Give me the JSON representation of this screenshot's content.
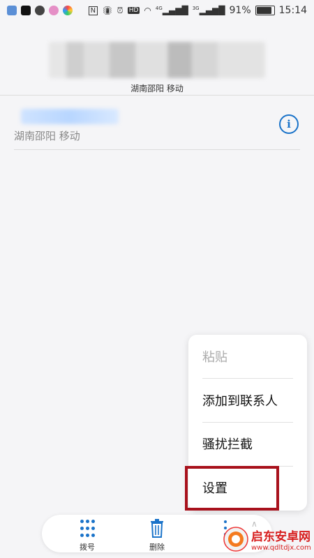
{
  "status_bar": {
    "signal_a": "4G",
    "signal_b": "3G",
    "battery_percent": "91%",
    "battery_level": 0.91,
    "time": "15:14",
    "hd_label": "HD",
    "nfc_label": "N"
  },
  "header": {
    "location": "湖南邵阳 移动"
  },
  "recent_call": {
    "location": "湖南邵阳 移动",
    "info_icon": "i"
  },
  "menu": {
    "items": [
      {
        "label": "粘贴",
        "enabled": false
      },
      {
        "label": "添加到联系人",
        "enabled": true
      },
      {
        "label": "骚扰拦截",
        "enabled": true
      },
      {
        "label": "设置",
        "enabled": true
      }
    ]
  },
  "bottom_bar": {
    "dial_label": "拨号",
    "delete_label": "删除"
  },
  "watermark": {
    "name": "启东安卓网",
    "url": "www.qdltdjx.com"
  },
  "colors": {
    "accent": "#1a73c9",
    "highlight": "#a8111c",
    "watermark": "#d71e1e"
  }
}
